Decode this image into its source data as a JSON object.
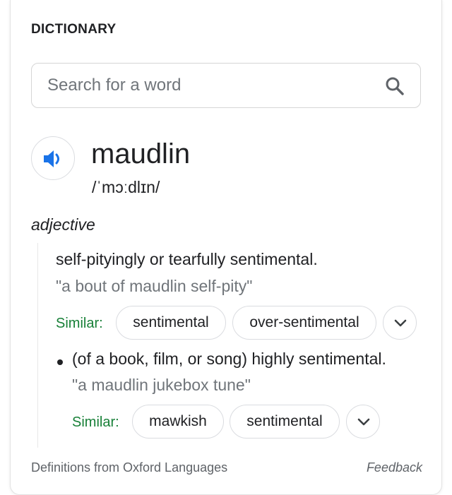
{
  "header": {
    "title": "DICTIONARY"
  },
  "search": {
    "placeholder": "Search for a word",
    "value": ""
  },
  "entry": {
    "word": "maudlin",
    "phonetic": "/ˈmɔːdlɪn/",
    "part_of_speech": "adjective",
    "senses": [
      {
        "definition": "self-pityingly or tearfully sentimental.",
        "example": "\"a bout of maudlin self-pity\"",
        "similar_label": "Similar:",
        "similar": [
          "sentimental",
          "over-sentimental"
        ]
      },
      {
        "definition": "(of a book, film, or song) highly sentimental.",
        "example": "\"a maudlin jukebox tune\"",
        "similar_label": "Similar:",
        "similar": [
          "mawkish",
          "sentimental"
        ]
      }
    ]
  },
  "footer": {
    "source": "Definitions from Oxford Languages",
    "feedback": "Feedback"
  },
  "icons": {
    "search": "search-icon",
    "audio": "speaker-icon",
    "expand": "chevron-down-icon"
  },
  "colors": {
    "accent_blue": "#1a73e8",
    "similar_green": "#188038",
    "example_gray": "#70757a"
  }
}
